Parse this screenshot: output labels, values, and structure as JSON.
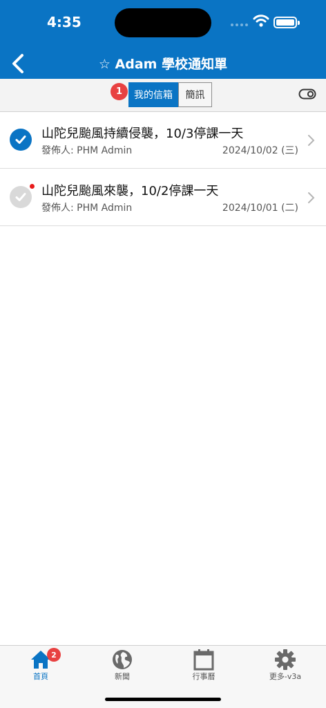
{
  "status_bar": {
    "time": "4:35"
  },
  "nav": {
    "title": "☆ Adam 學校通知單",
    "back_icon": "chevron-left-icon"
  },
  "segments": {
    "badge": "1",
    "inbox_label": "我的信箱",
    "sms_label": "簡訊",
    "toggle_icon": "toggle-icon"
  },
  "messages": [
    {
      "title": "山陀兒颱風持續侵襲，10/3停課一天",
      "sender": "發佈人: PHM Admin",
      "date": "2024/10/02 (三)",
      "read": true,
      "unread_dot": false
    },
    {
      "title": "山陀兒颱風來襲，10/2停課一天",
      "sender": "發佈人: PHM Admin",
      "date": "2024/10/01 (二)",
      "read": false,
      "unread_dot": true
    }
  ],
  "tabs": [
    {
      "label": "首頁",
      "icon": "home-icon",
      "active": true,
      "badge": "2"
    },
    {
      "label": "新聞",
      "icon": "globe-icon",
      "active": false
    },
    {
      "label": "行事曆",
      "icon": "calendar-icon",
      "active": false
    },
    {
      "label": "更多-v3a",
      "icon": "gear-icon",
      "active": false
    }
  ],
  "colors": {
    "brand": "#0a74c4",
    "badge": "#e84141",
    "unread": "#e81b1b"
  }
}
